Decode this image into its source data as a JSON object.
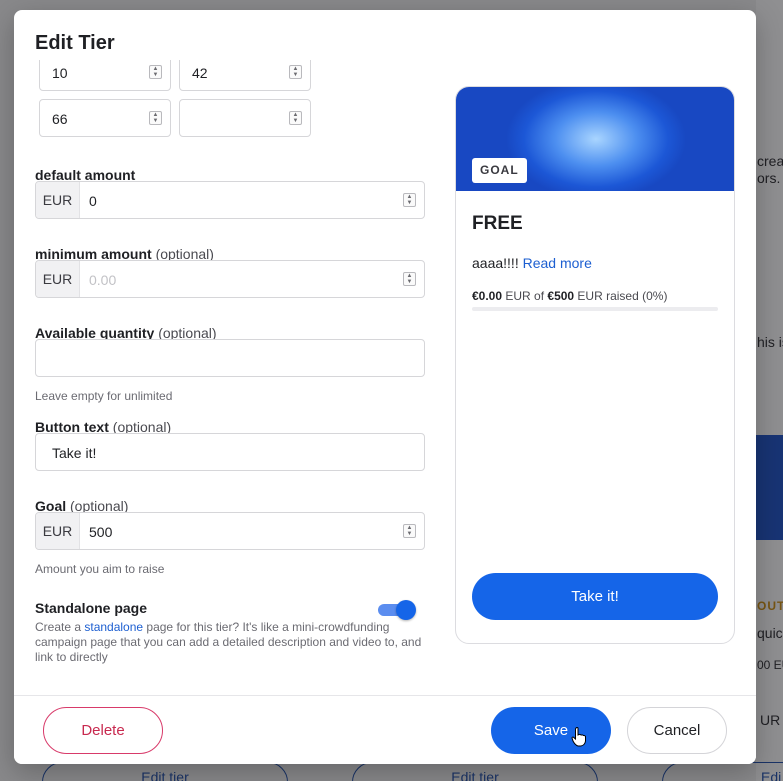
{
  "background": {
    "right_fragments": [
      "creat",
      "ors.",
      "his is",
      "OUT",
      "quic",
      "00 EU",
      "UR",
      "Edi"
    ],
    "edit_tier_label": "Edit tier"
  },
  "modal": {
    "title": "Edit Tier",
    "interval_inputs": [
      "10",
      "42",
      "66",
      ""
    ],
    "default_amount": {
      "label": "default amount",
      "currency": "EUR",
      "value": "0"
    },
    "minimum_amount": {
      "label": "minimum amount",
      "optional": "(optional)",
      "currency": "EUR",
      "placeholder": "0.00"
    },
    "available_quantity": {
      "label": "Available quantity",
      "optional": "(optional)",
      "value": "",
      "help": "Leave empty for unlimited"
    },
    "button_text": {
      "label": "Button text",
      "optional": "(optional)",
      "value": "Take it!"
    },
    "goal": {
      "label": "Goal",
      "optional": "(optional)",
      "currency": "EUR",
      "value": "500",
      "help": "Amount you aim to raise"
    },
    "standalone": {
      "label": "Standalone page",
      "enabled": true,
      "desc_before": "Create a ",
      "desc_link": "standalone",
      "desc_after": " page for this tier? It's like a mini-crowdfunding campaign page that you can add a detailed description and video to, and link to directly"
    },
    "preview": {
      "badge": "GOAL",
      "name": "FREE",
      "description": "aaaa!!!! ",
      "read_more": "Read more",
      "raised_amount": "€0.00",
      "raised_currency_text": " EUR of ",
      "goal_amount": "€500",
      "goal_suffix": " EUR raised (0%)",
      "progress_percent": 0,
      "cta_label": "Take it!"
    },
    "footer": {
      "delete_label": "Delete",
      "save_label": "Save",
      "cancel_label": "Cancel"
    }
  },
  "colors": {
    "primary": "#1565e8",
    "danger": "#c8294f",
    "link": "#1d5fd1"
  },
  "icons": [
    "spinner-arrows-icon",
    "hand-pointer-cursor-icon"
  ]
}
